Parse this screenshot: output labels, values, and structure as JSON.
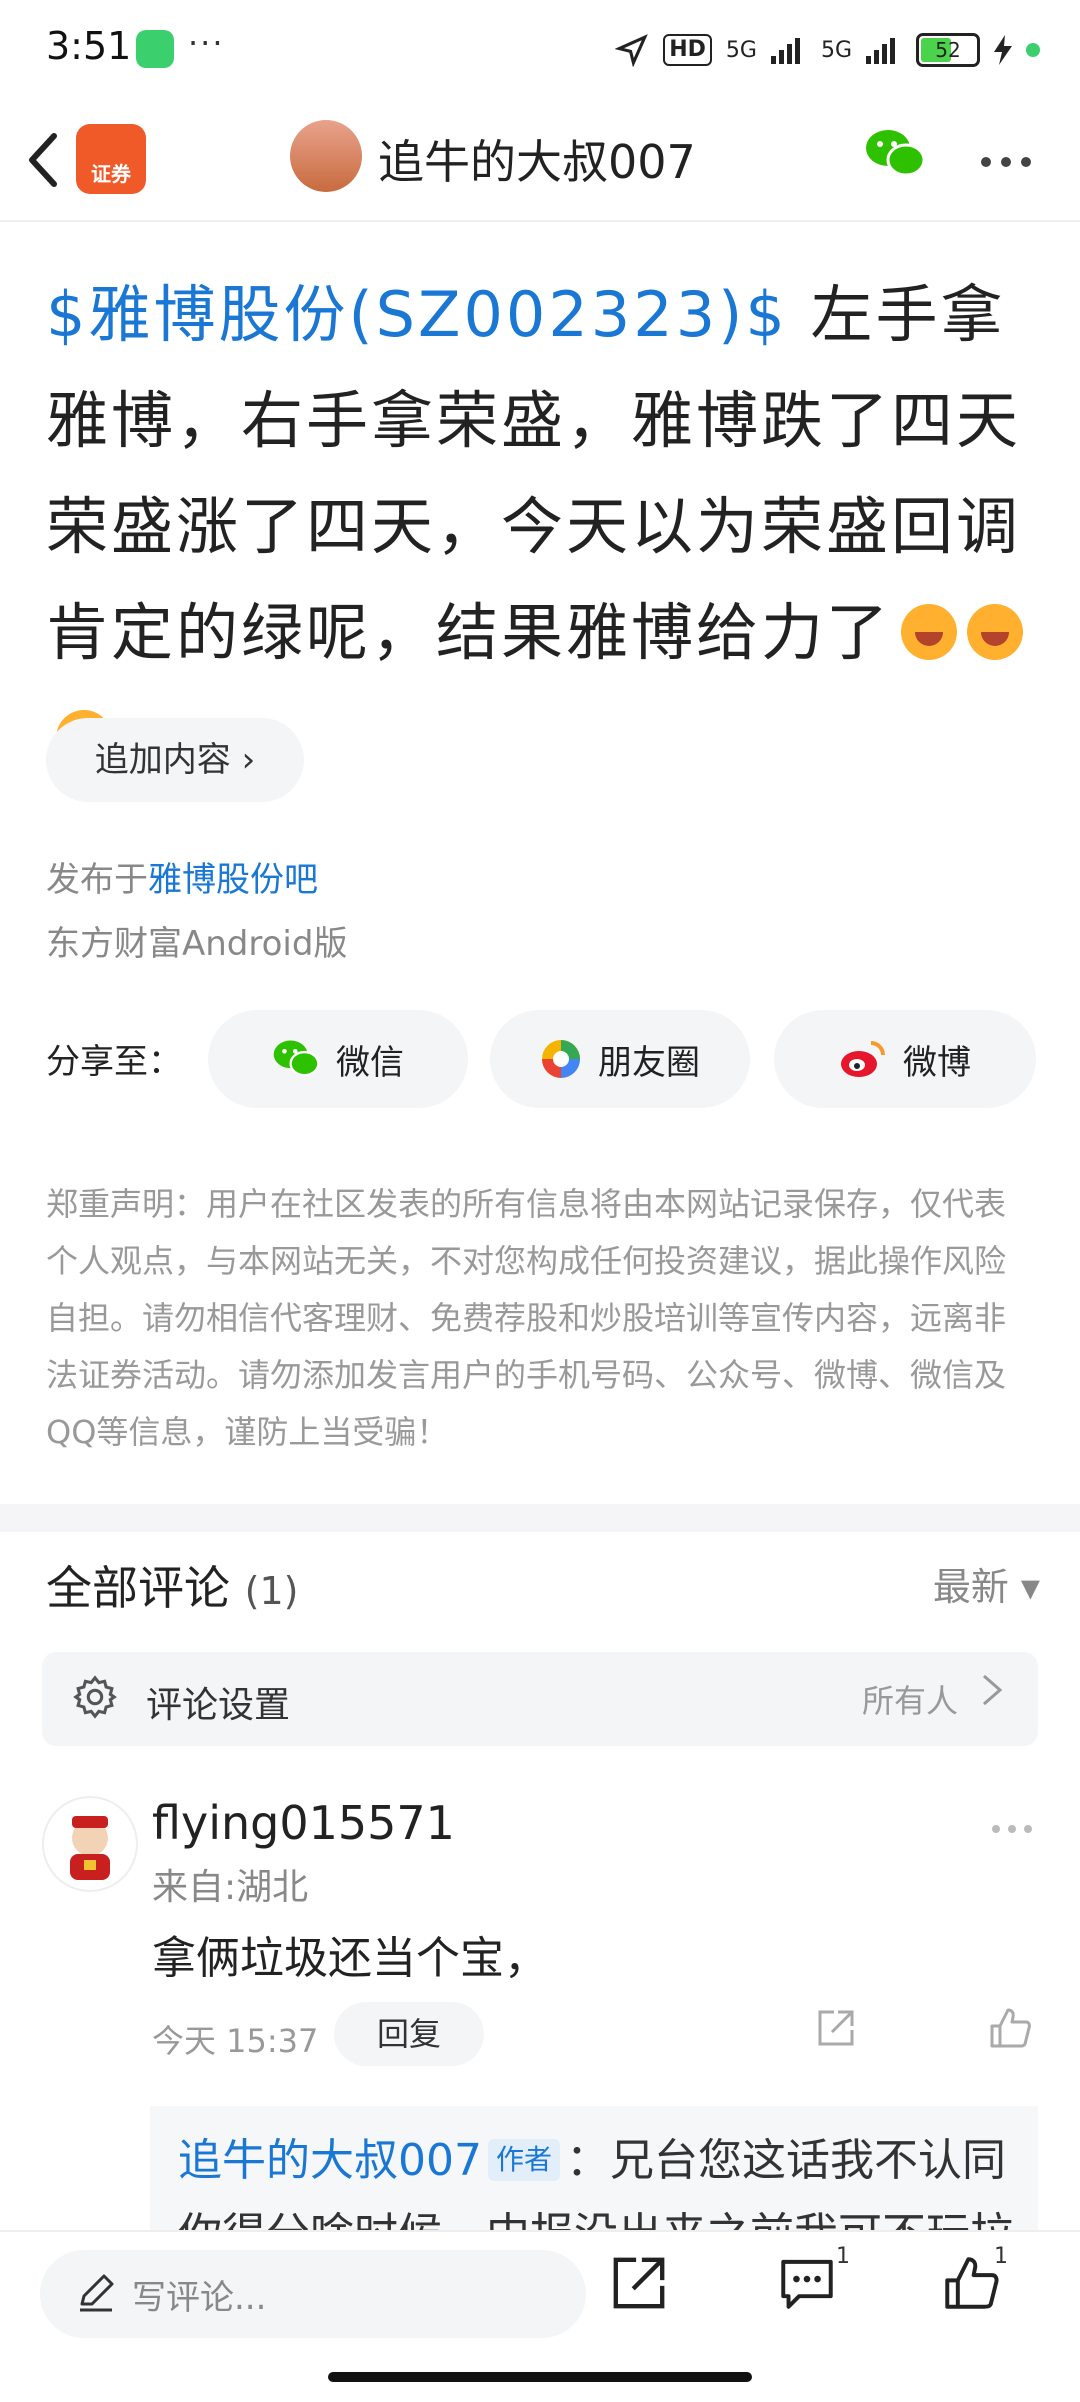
{
  "status_bar": {
    "time": "3:51",
    "dots": "···",
    "hd": "HD",
    "net1": "5G",
    "net2": "5G",
    "battery": "52"
  },
  "header": {
    "back_icon": "chevron-left-icon",
    "app_badge": "证券",
    "title": "追牛的大叔007"
  },
  "post": {
    "stock_tag": "$雅博股份(SZ002323)$",
    "body": " 左手拿雅博，右手拿荣盛，雅博跌了四天荣盛涨了四天，今天以为荣盛回调肯定的绿呢，结果雅博给力了",
    "add_content": "追加内容 ›",
    "published_prefix": "发布于",
    "published_in": "雅博股份吧",
    "device": "东方财富Android版"
  },
  "share": {
    "label": "分享至：",
    "items": [
      {
        "label": "微信",
        "icon": "wechat-icon"
      },
      {
        "label": "朋友圈",
        "icon": "moments-icon"
      },
      {
        "label": "微博",
        "icon": "weibo-icon"
      }
    ]
  },
  "disclaimer": "郑重声明：用户在社区发表的所有信息将由本网站记录保存，仅代表个人观点，与本网站无关，不对您构成任何投资建议，据此操作风险自担。请勿相信代客理财、免费荐股和炒股培训等宣传内容，远离非法证券活动。请勿添加发言用户的手机号码、公众号、微博、微信及QQ等信息，谨防上当受骗！",
  "comments": {
    "title": "全部评论",
    "count": "(1)",
    "sort": "最新 ▾",
    "settings_label": "评论设置",
    "settings_value": "所有人",
    "items": [
      {
        "user": "flying015571",
        "from": "来自:湖北",
        "text": "拿俩垃圾还当个宝，",
        "time": "今天 15:37",
        "reply_label": "回复",
        "sub_reply": {
          "user": "追牛的大叔007",
          "tag": "作者",
          "text": "：兄台您这话我不认同你得分啥时候，中报没出来之前我可不玩拉"
        }
      }
    ]
  },
  "bottom_bar": {
    "placeholder": "写评论...",
    "comment_count": "1",
    "like_count": "1"
  },
  "colors": {
    "accent": "#1a78d4",
    "brand": "#f05a28"
  }
}
